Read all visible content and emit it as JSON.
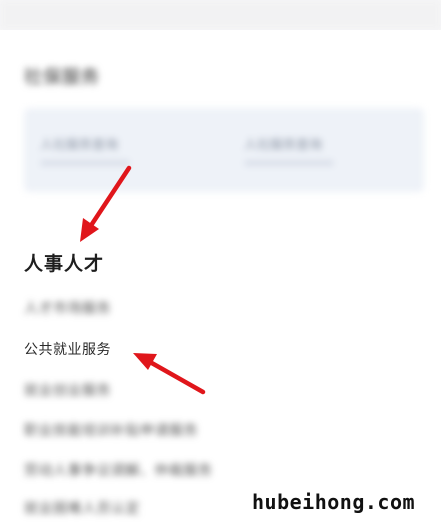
{
  "blurred": {
    "section_title": "社保服务",
    "quick_left": "人社服务查询",
    "quick_right": "人社服务查询",
    "items": [
      "人才市场服务",
      "就业创业服务",
      "职业技能培训补贴申请服务",
      "劳动人事争议调解、仲裁服务",
      "就业困难人员认定"
    ]
  },
  "section": {
    "title": "人事人才",
    "highlighted_item": "公共就业服务"
  },
  "watermark": "hubeihong.com",
  "colors": {
    "arrow": "#e0161b",
    "background": "#ffffff"
  }
}
